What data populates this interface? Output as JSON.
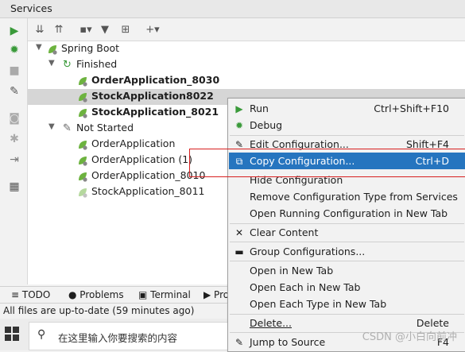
{
  "panel": {
    "title": "Services"
  },
  "tree": {
    "root": "Spring Boot",
    "finished_group": "Finished",
    "finished": [
      "OrderApplication_8030",
      "StockApplication8022",
      "StockApplication_8021"
    ],
    "not_started_group": "Not Started",
    "not_started": [
      "OrderApplication",
      "OrderApplication (1)",
      "OrderApplication_8010",
      "StockApplication_8011"
    ]
  },
  "menu": {
    "run": {
      "label": "Run",
      "shortcut": "Ctrl+Shift+F10"
    },
    "debug": {
      "label": "Debug"
    },
    "edit_config": {
      "label": "Edit Configuration...",
      "shortcut": "Shift+F4"
    },
    "copy_config": {
      "label": "Copy Configuration...",
      "shortcut": "Ctrl+D"
    },
    "hide_config": {
      "label": "Hide Configuration"
    },
    "remove_type": {
      "label": "Remove Configuration Type from Services"
    },
    "open_running": {
      "label": "Open Running Configuration in New Tab"
    },
    "clear_content": {
      "label": "Clear Content"
    },
    "group_configs": {
      "label": "Group Configurations..."
    },
    "open_new_tab": {
      "label": "Open in New Tab"
    },
    "open_each": {
      "label": "Open Each in New Tab"
    },
    "open_each_type": {
      "label": "Open Each Type in New Tab"
    },
    "delete": {
      "label": "Delete...",
      "shortcut": "Delete"
    },
    "jump_source": {
      "label": "Jump to Source",
      "shortcut": "F4"
    }
  },
  "bottom_tabs": {
    "todo": "TODO",
    "problems": "Problems",
    "terminal": "Terminal",
    "partial": "Pro"
  },
  "status": {
    "text": "All files are up-to-date (59 minutes ago)"
  },
  "taskbar": {
    "search_placeholder": "在这里输入你要搜索的内容"
  },
  "watermark": "CSDN @小白向前冲",
  "colors": {
    "accent": "#2675bf",
    "run_green": "#3a9a3a",
    "spring_green": "#6db33f",
    "highlight_border": "#d82020"
  }
}
